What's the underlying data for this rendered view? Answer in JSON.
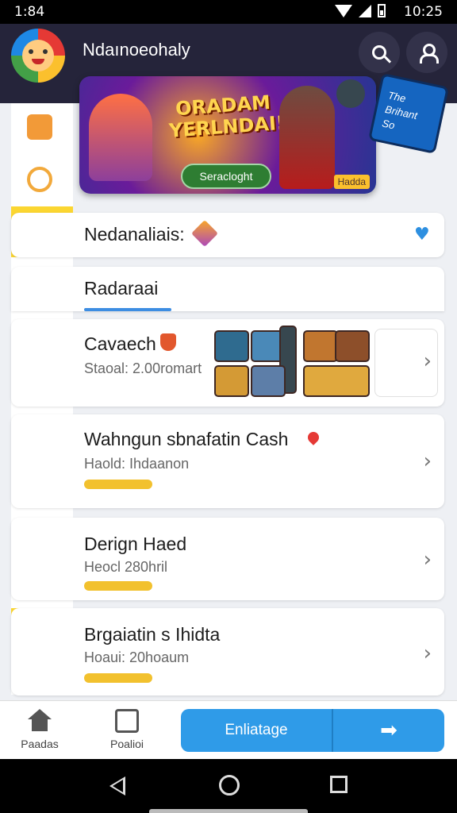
{
  "status_bar": {
    "time_left": "1:84",
    "time_right": "10:25"
  },
  "header": {
    "title": "Ndaınoeohaly"
  },
  "banner": {
    "title": "ORADAM YERLNDAI!",
    "button": "Seracloght",
    "tag": "Hadda"
  },
  "side_card": {
    "text": "The Brihant So"
  },
  "rows": [
    {
      "title": "Nedanaliais:"
    },
    {
      "title": "Radaraai"
    },
    {
      "title": "Cavaech",
      "subtitle": "Staoal: 2.00romart"
    },
    {
      "title": "Wahngun sbnafatin Cash",
      "subtitle": "Haold: Ihdaanon"
    },
    {
      "title": "Derign Haed",
      "subtitle": "Heocl 280hril"
    },
    {
      "title": "Brgaiatin s Ihidta",
      "subtitle": "Hoaui: 20hoaum"
    }
  ],
  "bottom_nav": {
    "item1": "Paadas",
    "item2": "Poalioi",
    "cta": "Enliatage",
    "cta_arrow": "➡"
  },
  "icons": {
    "chevron": "›",
    "heart": "♥"
  },
  "colors": {
    "accent": "#2f9be8",
    "progress": "#f2c12e",
    "header_bg": "#25243a",
    "rail_highlight": "#fbd631"
  }
}
